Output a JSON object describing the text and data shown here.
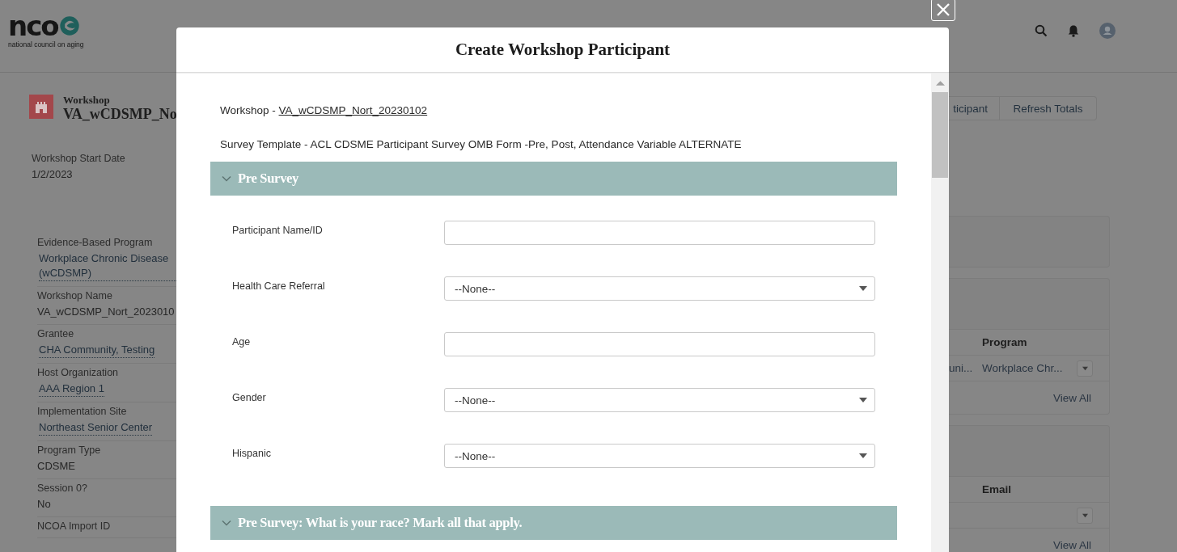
{
  "header": {
    "logo": {
      "wordmark": "nco",
      "tagline": "national council on aging"
    }
  },
  "record": {
    "object_type": "Workshop",
    "title": "VA_wCDSMP_No",
    "date_label": "Workshop Start Date",
    "date_value": "1/2/2023"
  },
  "fields": [
    {
      "label": "Evidence-Based Program",
      "value": "Workplace Chronic Disease (wCDSMP)",
      "link": true
    },
    {
      "label": "Workshop Name",
      "value": "VA_wCDSMP_Nort_2023010",
      "link": false
    },
    {
      "label": "Grantee",
      "value": "CHA Community, Testing",
      "link": true
    },
    {
      "label": "Host Organization",
      "value": "AAA Region 1",
      "link": true
    },
    {
      "label": "Implementation Site",
      "value": "Northeast Senior Center",
      "link": true
    },
    {
      "label": "Program Type",
      "value": "CDSME",
      "link": false
    },
    {
      "label": "Session 0?",
      "value": "No",
      "link": false
    },
    {
      "label": "NCOA Import ID"
    }
  ],
  "actions": [
    {
      "label": "ticipant"
    },
    {
      "label": "Refresh Totals"
    }
  ],
  "related": [
    {
      "kind": "empty"
    },
    {
      "kind": "table",
      "column": "Program",
      "rows": [
        {
          "cells": [
            "uni...",
            "Workplace Chr..."
          ],
          "menu": true
        }
      ],
      "footer": "View All"
    },
    {
      "kind": "table",
      "column": "Email",
      "rows": [
        {
          "menu": true
        }
      ],
      "footer": "View All"
    }
  ],
  "modal": {
    "title": "Create Workshop Participant",
    "workshop": {
      "prefix": "Workshop - ",
      "link": "VA_wCDSMP_Nort_20230102"
    },
    "template": "Survey Template - ACL CDSME Participant Survey OMB Form -Pre, Post, Attendance Variable ALTERNATE",
    "sections": [
      {
        "title": "Pre Survey",
        "expanded": true,
        "fields": [
          {
            "label": "Participant Name/ID",
            "kind": "text"
          },
          {
            "label": "Health Care Referral",
            "kind": "select",
            "value": "--None--"
          },
          {
            "label": "Age",
            "kind": "text"
          },
          {
            "label": "Gender",
            "kind": "select",
            "value": "--None--"
          },
          {
            "label": "Hispanic",
            "kind": "select",
            "value": "--None--"
          }
        ]
      },
      {
        "title": "Pre Survey: What is your race? Mark all that apply.",
        "expanded": true
      }
    ]
  }
}
